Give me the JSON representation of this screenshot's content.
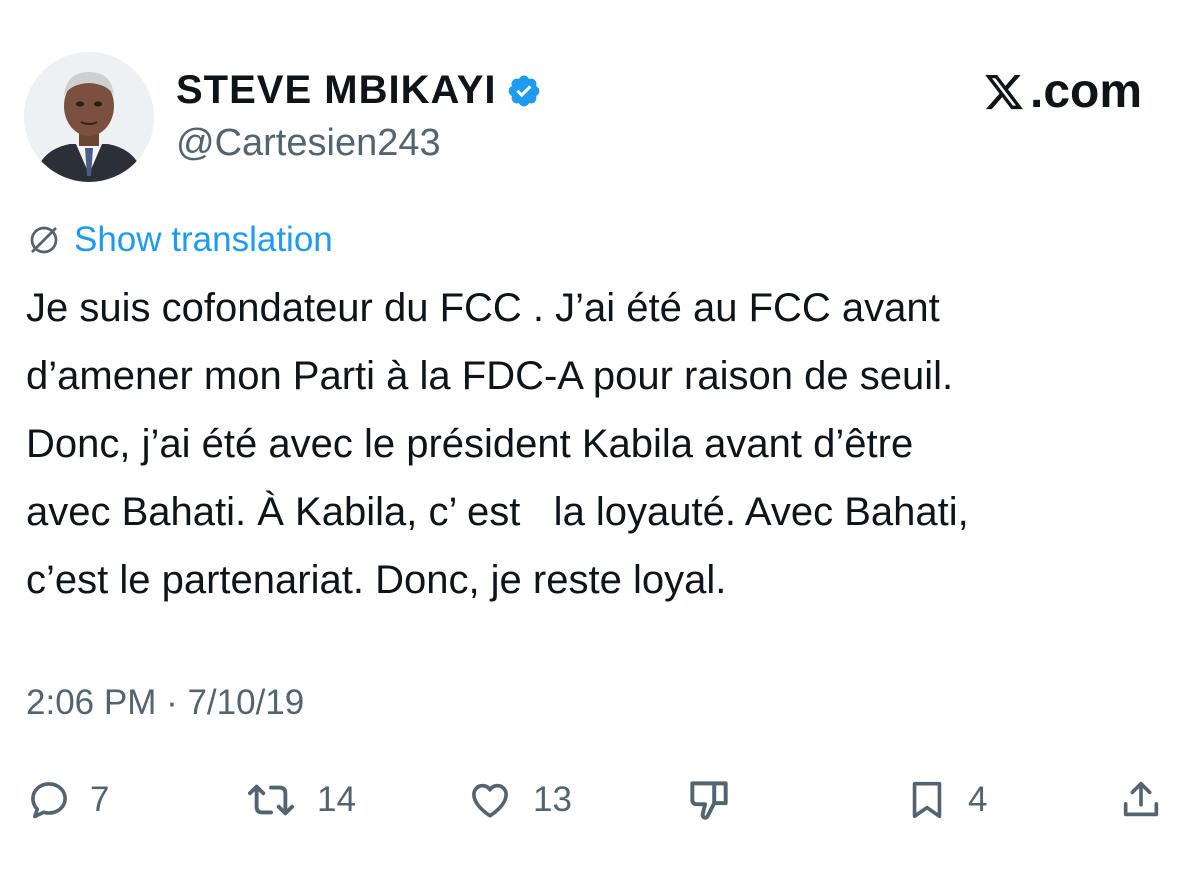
{
  "author": {
    "display_name": "STEVE  MBIKAYI",
    "handle": "@Cartesien243",
    "verified": true
  },
  "brand": {
    "label": ".com",
    "logo": "x-logo"
  },
  "show_translation_label": "Show translation",
  "tweet_lines": [
    "Je suis cofondateur du FCC . J’ai été au FCC avant",
    "d’amener mon Parti à la FDC-A pour raison de seuil.",
    "Donc, j’ai été avec le président Kabila avant d’être",
    "avec Bahati. À Kabila, c’ est   la loyauté. Avec Bahati,",
    "c’est le partenariat. Donc, je reste loyal."
  ],
  "timestamp": "2:06 PM · 7/10/19",
  "actions": {
    "reply_count": "7",
    "retweet_count": "14",
    "like_count": "13",
    "bookmark_count": "4"
  },
  "colors": {
    "accent": "#1d9bf0",
    "muted": "#536471",
    "text": "#0f1419"
  }
}
